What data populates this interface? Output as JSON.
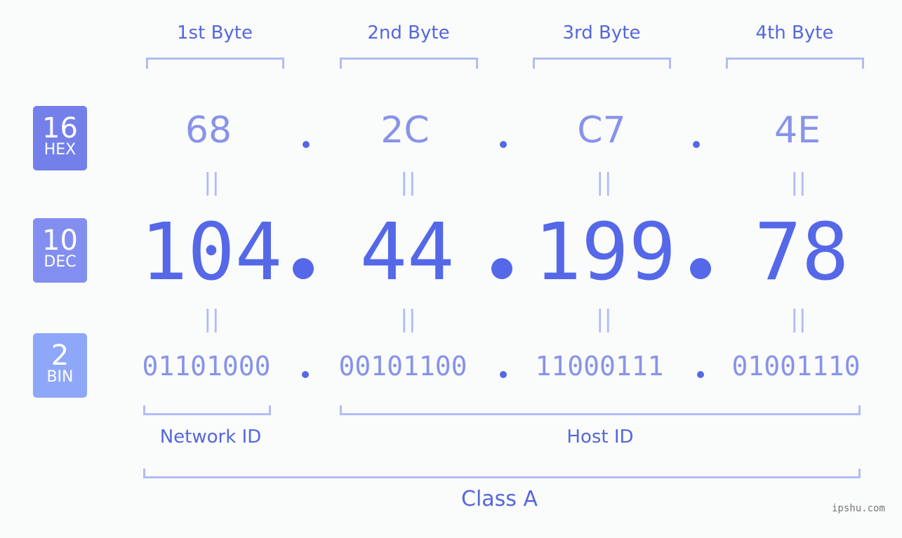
{
  "bases": [
    {
      "num": "16",
      "label": "HEX",
      "color": "#7480ea"
    },
    {
      "num": "10",
      "label": "DEC",
      "color": "#838ff0"
    },
    {
      "num": "2",
      "label": "BIN",
      "color": "#8ea7f8"
    }
  ],
  "bytes": [
    {
      "label": "1st Byte",
      "hex": "68",
      "dec": "104",
      "bin": "01101000"
    },
    {
      "label": "2nd Byte",
      "hex": "2C",
      "dec": "44",
      "bin": "00101100"
    },
    {
      "label": "3rd Byte",
      "hex": "C7",
      "dec": "199",
      "bin": "11000111"
    },
    {
      "label": "4th Byte",
      "hex": "4E",
      "dec": "78",
      "bin": "01001110"
    }
  ],
  "equals_symbol": "||",
  "network_id_label": "Network ID",
  "host_id_label": "Host ID",
  "class_label": "Class A",
  "watermark": "ipshu.com"
}
